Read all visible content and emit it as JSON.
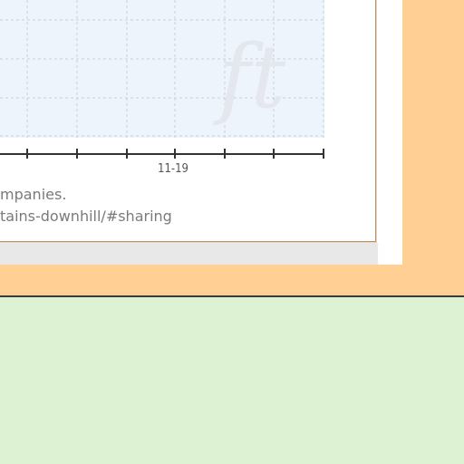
{
  "colors": {
    "outer_top": "#ffcf94",
    "outer_bottom": "#dcf2d2",
    "plot_fill": "#eef4fb",
    "grid": "#c8cfd8",
    "axis": "#333333",
    "watermark": "#e4e8ee"
  },
  "chart_data": {
    "type": "line",
    "title": "",
    "xlabel": "",
    "ylabel": "",
    "x_tick_labels": [
      "11-19"
    ],
    "grid": true,
    "series": []
  },
  "caption": {
    "line1": "mpanies.",
    "line2": "tains-downhill/#sharing"
  },
  "watermark": {
    "glyph": "ft"
  }
}
